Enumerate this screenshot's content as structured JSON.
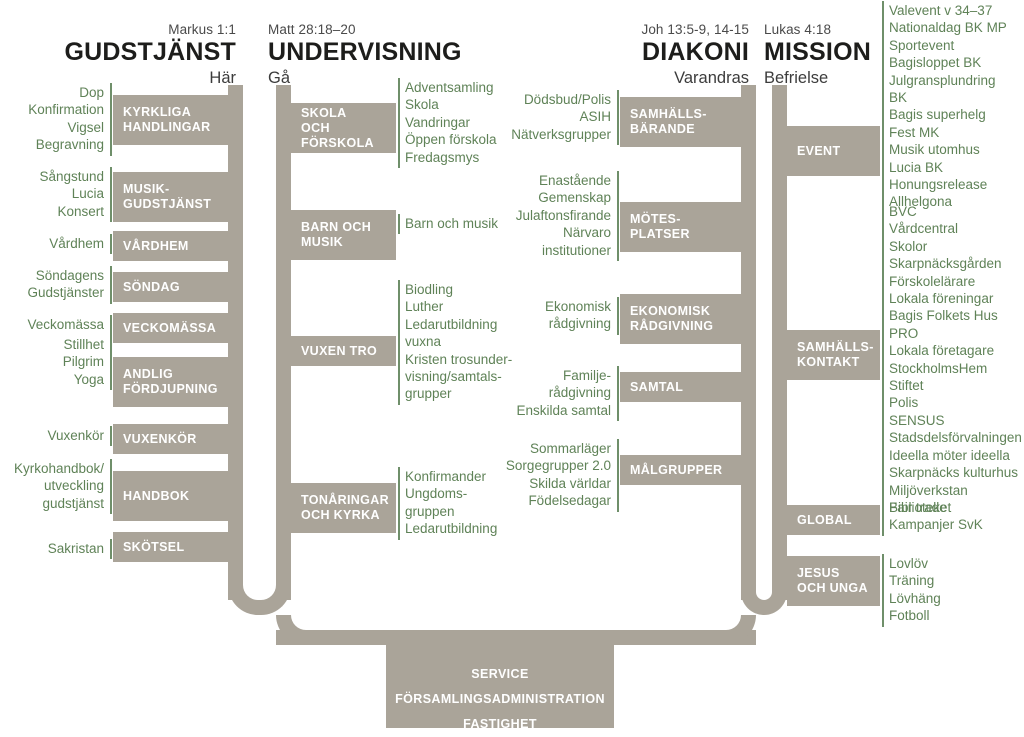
{
  "palette": {
    "trunk": "#aaa499",
    "branch": "#aaa499",
    "green_rule": "#6f8f6a",
    "leaf_text": "#5f8257",
    "heading": "#1d1d1b",
    "branch_label": "#ffffff",
    "background": "#ffffff"
  },
  "columns": [
    {
      "id": "gudstjanst",
      "reference": "Markus 1:1",
      "title": "GUDSTJÄNST",
      "subtitle": "Här",
      "align": "right",
      "branches": [
        {
          "label": "KYRKLIGA\nHANDLINGAR",
          "leaves": "Dop\nKonfirmation\nVigsel\nBegravning"
        },
        {
          "label": "MUSIK-\nGUDSTJÄNST",
          "leaves": "Sångstund\nLucia\nKonsert"
        },
        {
          "label": "VÅRDHEM",
          "leaves": "Vårdhem"
        },
        {
          "label": "SÖNDAG",
          "leaves": "Söndagens\nGudstjänster"
        },
        {
          "label": "VECKOMÄSSA",
          "leaves": "Veckomässa"
        },
        {
          "label": "ANDLIG\nFÖRDJUPNING",
          "leaves": "Stillhet\nPilgrim\nYoga"
        },
        {
          "label": "VUXENKÖR",
          "leaves": "Vuxenkör"
        },
        {
          "label": "HANDBOK",
          "leaves": "Kyrkohandbok/\nutveckling\ngudstjänst"
        },
        {
          "label": "SKÖTSEL",
          "leaves": "Sakristan"
        }
      ]
    },
    {
      "id": "undervisning",
      "reference": "Matt 28:18–20",
      "title": "UNDERVISNING",
      "subtitle": "Gå",
      "align": "left",
      "branches": [
        {
          "label": "SKOLA\nOCH FÖRSKOLA",
          "leaves": "Adventsamling\nSkola\nVandringar\nÖppen förskola\nFredagsmys"
        },
        {
          "label": "BARN OCH\nMUSIK",
          "leaves": "Barn och musik"
        },
        {
          "label": "VUXEN TRO",
          "leaves": "Biodling\nLuther\nLedarutbildning\nvuxna\nKristen trosunder-\nvisning/samtals-\ngrupper"
        },
        {
          "label": "TONÅRINGAR\nOCH KYRKA",
          "leaves": "Konfirmander\nUngdoms-\ngruppen\nLedarutbildning"
        }
      ]
    },
    {
      "id": "diakoni",
      "reference": "Joh 13:5-9, 14-15",
      "title": "DIAKONI",
      "subtitle": "Varandras",
      "align": "right",
      "branches": [
        {
          "label": "SAMHÄLLS-\nBÄRANDE",
          "leaves": "Dödsbud/Polis\nASIH\nNätverksgrupper"
        },
        {
          "label": "MÖTES-\nPLATSER",
          "leaves": "Enastående\nGemenskap\nJulaftonsfirande\nNärvaro\ninstitutioner"
        },
        {
          "label": "EKONOMISK\nRÅDGIVNING",
          "leaves": "Ekonomisk\nrådgivning"
        },
        {
          "label": "SAMTAL",
          "leaves": "Familje-\nrådgivning\nEnskilda samtal"
        },
        {
          "label": "MÅLGRUPPER",
          "leaves": "Sommarläger\nSorgegrupper 2.0\nSkilda världar\nFödelsedagar"
        }
      ]
    },
    {
      "id": "mission",
      "reference": "Lukas 4:18",
      "title": "MISSION",
      "subtitle": "Befrielse",
      "align": "left",
      "branches": [
        {
          "label": "EVENT",
          "leaves": "Valevent v 34–37\nNationaldag BK MP\nSportevent\nBagisloppet BK\nJulgransplundring\nBK\nBagis superhelg\nFest MK\nMusik utomhus\nLucia BK\nHonungsrelease\nAllhelgona"
        },
        {
          "label": "SAMHÄLLS-\nKONTAKT",
          "leaves": "BVC\nVårdcentral\nSkolor\nSkarpnäcksgården\nFörskolelärare\nLokala föreningar\nBagis Folkets Hus\nPRO\nLokala företagare\nStockholmsHem\nStiftet\nPolis\nSENSUS\nStadsdelsförvalningen\nIdeella möter ideella\nSkarpnäcks kulturhus\nMiljöverkstan\nBiblioteket"
        },
        {
          "label": "GLOBAL",
          "leaves": "Fair trade\nKampanjer SvK"
        },
        {
          "label": "JESUS\nOCH UNGA",
          "leaves": "Lovlöv\nTräning\nLövhäng\nFotboll"
        }
      ]
    }
  ],
  "service": {
    "lines": [
      "SERVICE",
      "FÖRSAMLINGSADMINISTRATION",
      "FASTIGHET"
    ]
  }
}
